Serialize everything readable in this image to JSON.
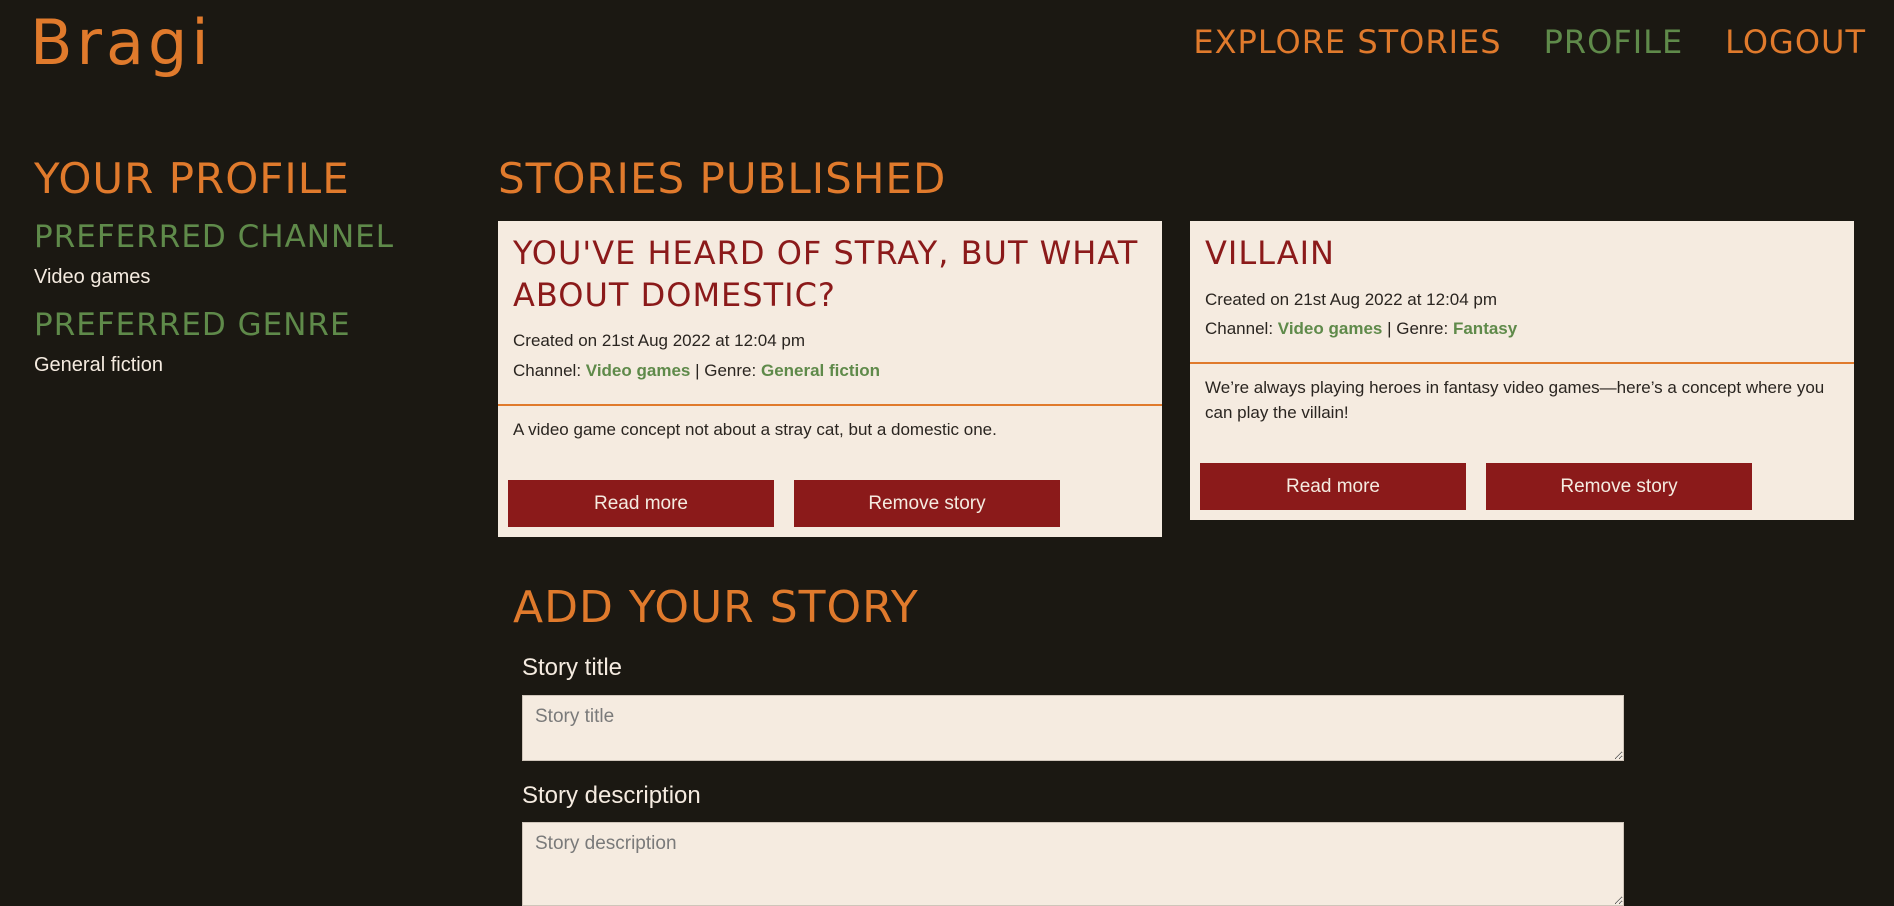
{
  "header": {
    "logo": "Bragi",
    "nav": [
      {
        "label": "Explore stories",
        "active": false
      },
      {
        "label": "Profile",
        "active": true
      },
      {
        "label": "Logout",
        "active": false
      }
    ]
  },
  "profile": {
    "title": "Your Profile",
    "channel_heading": "Preferred Channel",
    "channel_value": "Video games",
    "genre_heading": "Preferred Genre",
    "genre_value": "General fiction"
  },
  "stories": {
    "title": "Stories Published",
    "items": [
      {
        "title": "You've heard of Stray, but what about Domestic?",
        "created": "Created on 21st Aug 2022 at 12:04 pm",
        "channel_label": "Channel:",
        "channel": "Video games",
        "genre_label": "| Genre:",
        "genre": "General fiction",
        "description": "A video game concept not about a stray cat, but a domestic one.",
        "read_more": "Read more",
        "remove": "Remove story"
      },
      {
        "title": "Villain",
        "created": "Created on 21st Aug 2022 at 12:04 pm",
        "channel_label": "Channel:",
        "channel": "Video games",
        "genre_label": "| Genre:",
        "genre": "Fantasy",
        "description": "We’re always playing heroes in fantasy video games—here’s a concept where you can play the villain!",
        "read_more": "Read more",
        "remove": "Remove story"
      }
    ]
  },
  "add_story": {
    "title": "Add your story",
    "title_label": "Story title",
    "title_placeholder": "Story title",
    "description_label": "Story description",
    "description_placeholder": "Story description"
  },
  "colors": {
    "background": "#1b1812",
    "accent_orange": "#e07a2c",
    "accent_green": "#5f8a4a",
    "card": "#f5ebe0",
    "button": "#8b1a1a"
  }
}
